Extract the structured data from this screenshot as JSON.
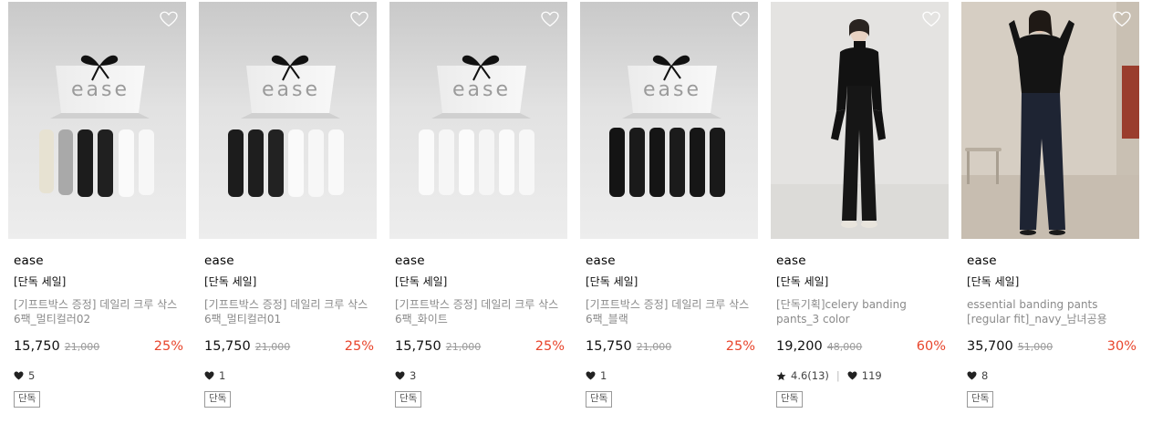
{
  "products": [
    {
      "brand": "ease",
      "tag": "[단독 세일]",
      "name": "[기프트박스 증정] 데일리 크루 삭스 6팩_멀티컬러02",
      "price": "15,750",
      "original_price": "21,000",
      "discount": "25%",
      "likes": "5",
      "badge": "단독",
      "image": "gift-box-socks-multicolor02"
    },
    {
      "brand": "ease",
      "tag": "[단독 세일]",
      "name": "[기프트박스 증정] 데일리 크루 삭스 6팩_멀티컬러01",
      "price": "15,750",
      "original_price": "21,000",
      "discount": "25%",
      "likes": "1",
      "badge": "단독",
      "image": "gift-box-socks-multicolor01"
    },
    {
      "brand": "ease",
      "tag": "[단독 세일]",
      "name": "[기프트박스 증정] 데일리 크루 삭스 6팩_화이트",
      "price": "15,750",
      "original_price": "21,000",
      "discount": "25%",
      "likes": "3",
      "badge": "단독",
      "image": "gift-box-socks-white"
    },
    {
      "brand": "ease",
      "tag": "[단독 세일]",
      "name": "[기프트박스 증정] 데일리 크루 삭스 6팩_블랙",
      "price": "15,750",
      "original_price": "21,000",
      "discount": "25%",
      "likes": "1",
      "badge": "단독",
      "image": "gift-box-socks-black"
    },
    {
      "brand": "ease",
      "tag": "[단독 세일]",
      "name": "[단독기획]celery banding pants_3 color",
      "price": "19,200",
      "original_price": "48,000",
      "discount": "60%",
      "rating": "4.6(13)",
      "likes": "119",
      "badge": "단독",
      "image": "model-black-outfit-studio"
    },
    {
      "brand": "ease",
      "tag": "[단독 세일]",
      "name": "essential banding pants [regular fit]_navy_남녀공용",
      "price": "35,700",
      "original_price": "51,000",
      "discount": "30%",
      "likes": "8",
      "badge": "단독",
      "image": "model-navy-pants-room"
    }
  ],
  "colors": {
    "discount": "#e8452c",
    "muted": "#8a8a8a",
    "strike": "#9a9a9a"
  }
}
